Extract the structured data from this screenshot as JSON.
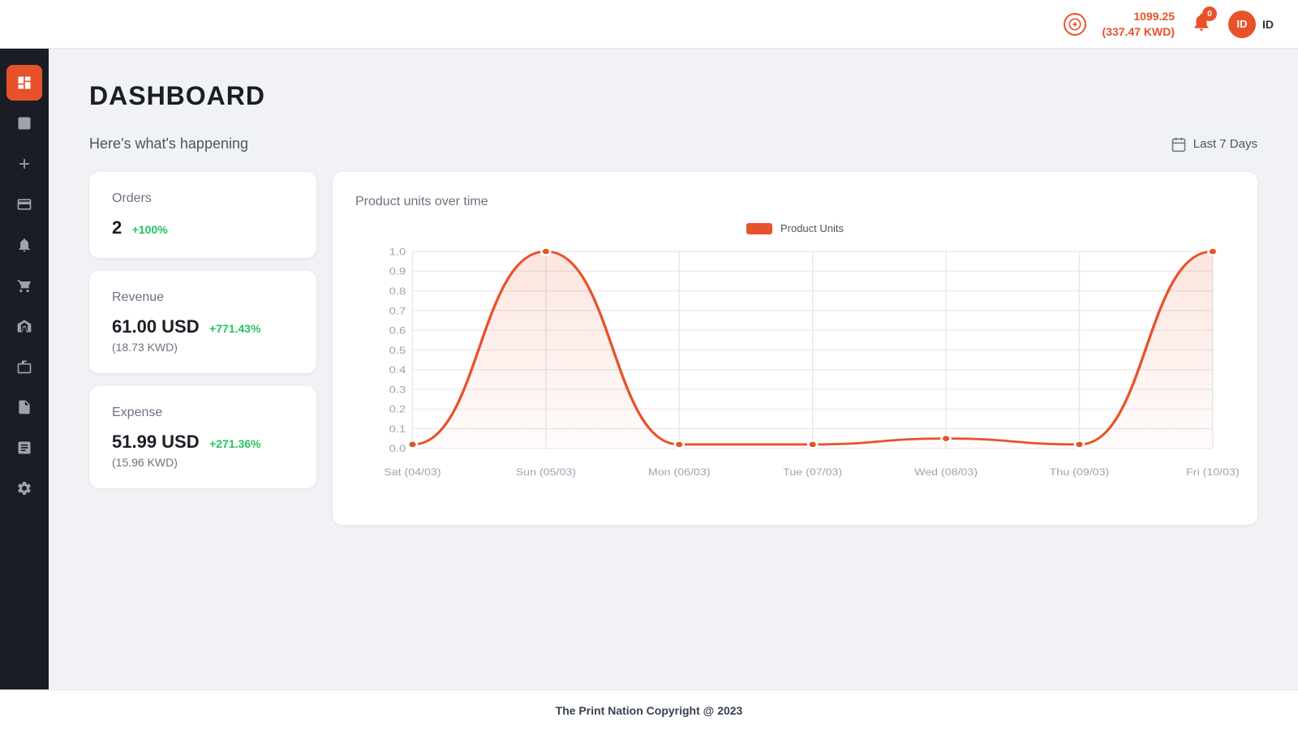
{
  "header": {
    "balance_line1": "1099.25",
    "balance_line2": "(337.47 KWD)",
    "add_label": "+",
    "bell_count": "0",
    "user_initials": "ID",
    "user_label": "ID"
  },
  "sidebar": {
    "items": [
      {
        "id": "dashboard",
        "icon": "grid",
        "active": true
      },
      {
        "id": "reports",
        "icon": "bar-chart",
        "active": false
      },
      {
        "id": "add",
        "icon": "plus",
        "active": false
      },
      {
        "id": "cards",
        "icon": "credit-card",
        "active": false
      },
      {
        "id": "notifications",
        "icon": "bell",
        "active": false
      },
      {
        "id": "cart",
        "icon": "shopping-cart",
        "active": false
      },
      {
        "id": "shop",
        "icon": "store",
        "active": false
      },
      {
        "id": "briefcase",
        "icon": "briefcase",
        "active": false
      },
      {
        "id": "files",
        "icon": "file",
        "active": false
      },
      {
        "id": "invoice",
        "icon": "file-text",
        "active": false
      },
      {
        "id": "settings",
        "icon": "settings",
        "active": false
      }
    ]
  },
  "page": {
    "title": "DASHBOARD",
    "subtitle": "Here's what's happening",
    "date_filter_label": "Last 7 Days"
  },
  "cards": {
    "orders": {
      "title": "Orders",
      "value": "2",
      "change": "+100%",
      "change_positive": true
    },
    "revenue": {
      "title": "Revenue",
      "value": "61.00 USD",
      "change": "+771.43%",
      "sub": "(18.73 KWD)",
      "change_positive": true
    },
    "expense": {
      "title": "Expense",
      "value": "51.99 USD",
      "change": "+271.36%",
      "sub": "(15.96 KWD)",
      "change_positive": true
    }
  },
  "chart": {
    "title": "Product units over time",
    "legend_label": "Product Units",
    "accent_color": "#e8522a",
    "x_labels": [
      "Sat (04/03)",
      "Sun (05/03)",
      "Mon (06/03)",
      "Tue (07/03)",
      "Wed (08/03)",
      "Thu (09/03)",
      "Fri (10/03)"
    ],
    "y_labels": [
      "0",
      "0.1",
      "0.2",
      "0.3",
      "0.4",
      "0.5",
      "0.6",
      "0.7",
      "0.8",
      "0.9",
      "1.0"
    ],
    "data_points": [
      0.02,
      1.0,
      0.02,
      0.02,
      0.05,
      0.02,
      1.0
    ]
  },
  "footer": {
    "text": "The Print Nation Copyright @ 2023"
  }
}
